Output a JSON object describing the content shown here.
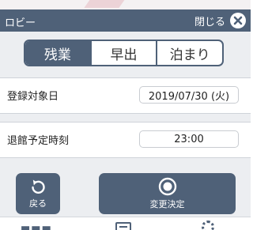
{
  "colors": {
    "header": "#4f6178",
    "panel": "#eceef1",
    "text": "#222222"
  },
  "header": {
    "title": "ロビー",
    "close_label": "閉じる"
  },
  "modes": {
    "tabs": [
      "残業",
      "早出",
      "泊まり"
    ],
    "selected": "残業"
  },
  "form": {
    "registration_date": {
      "label": "登録対象日",
      "value": "2019/07/30 (火)"
    },
    "departure_time": {
      "label": "退館予定時刻",
      "value": "23:00"
    }
  },
  "actions": {
    "back_label": "戻る",
    "confirm_label": "変更決定"
  },
  "tabbar": {
    "icons": [
      "logo",
      "document-icon",
      "gear-icon"
    ]
  }
}
